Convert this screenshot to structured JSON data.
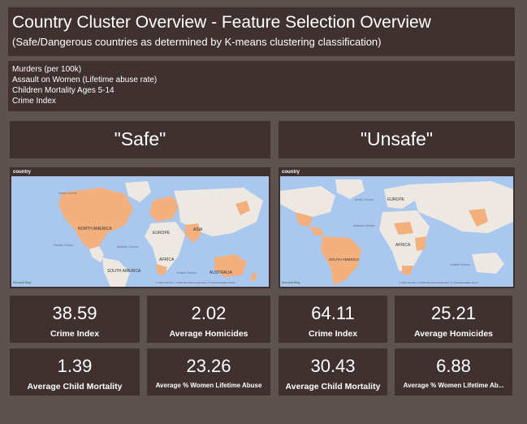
{
  "title": "Country Cluster Overview - Feature Selection Overview",
  "subtitle": "(Safe/Dangerous countries as determined by K-means clustering classification)",
  "features": [
    "Murders (per 100k)",
    "Assault on Women (Lifetime abuse rate)",
    "Children Mortality Ages 5-14",
    "Crime Index"
  ],
  "safe": {
    "header": "\"Safe\"",
    "map_label": "country",
    "map_texts": {
      "arctic": "Arctic Ocean",
      "north_america": "NORTH AMERICA",
      "europe": "EUROPE",
      "asia": "ASIA",
      "africa": "AFRICA",
      "south_america": "SOUTH AMERICA",
      "australia": "AUSTRALIA",
      "pacific": "Pacific Ocean",
      "atlantic": "Atlantic Ocean",
      "indian": "Indian Ocean",
      "bing": "Microsoft Bing",
      "copyright": "© 2022 TomTom, © 2022 Microsoft Corporation, © OpenStreetMap Terms"
    },
    "kpis": [
      {
        "value": "38.59",
        "label": "Crime Index"
      },
      {
        "value": "2.02",
        "label": "Average Homicides"
      },
      {
        "value": "1.39",
        "label": "Average Child Mortality"
      },
      {
        "value": "23.26",
        "label": "Average % Women Lifetime Abuse"
      }
    ]
  },
  "unsafe": {
    "header": "\"Unsafe\"",
    "map_label": "country",
    "map_texts": {
      "arctic": "Arctic Ocean",
      "europe": "EUROPE",
      "atlantic": "Atlantic Ocean",
      "africa": "AFRICA",
      "south_america": "SOUTH AMERICA",
      "indian": "Indian Ocean",
      "bing": "Microsoft Bing",
      "copyright": "© 2022 TomTom, © 2022 Microsoft Corporation, © OpenStreetMap Terms"
    },
    "kpis": [
      {
        "value": "64.11",
        "label": "Crime Index"
      },
      {
        "value": "25.21",
        "label": "Average Homicides"
      },
      {
        "value": "30.43",
        "label": "Average Child Mortality"
      },
      {
        "value": "6.88",
        "label": "Average % Women Lifetime Ab..."
      }
    ]
  },
  "colors": {
    "background": "#5e5250",
    "panel": "#3f3130",
    "ocean": "#a9c7ef",
    "land": "#ede9e2",
    "highlight": "#f3b07c"
  }
}
